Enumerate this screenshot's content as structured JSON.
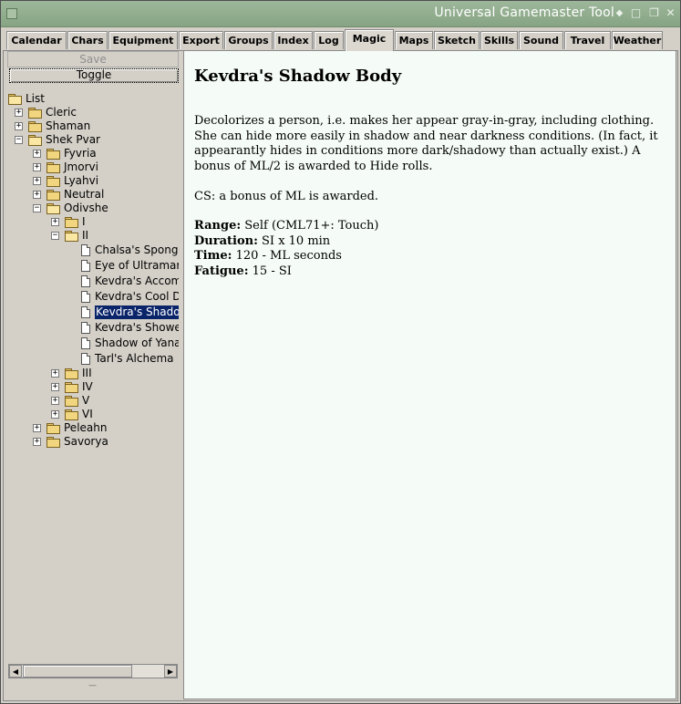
{
  "window": {
    "title": "Universal Gamemaster Tool"
  },
  "tabs": [
    {
      "label": "Calendar",
      "active": false
    },
    {
      "label": "Chars",
      "active": false
    },
    {
      "label": "Equipment",
      "active": false
    },
    {
      "label": "Export",
      "active": false
    },
    {
      "label": "Groups",
      "active": false
    },
    {
      "label": "Index",
      "active": false
    },
    {
      "label": "Log",
      "active": false
    },
    {
      "label": "Magic",
      "active": true
    },
    {
      "label": "Maps",
      "active": false
    },
    {
      "label": "Sketch",
      "active": false
    },
    {
      "label": "Skills",
      "active": false
    },
    {
      "label": "Sound",
      "active": false
    },
    {
      "label": "Travel",
      "active": false
    },
    {
      "label": "Weather",
      "active": false
    }
  ],
  "sidebar": {
    "save_label": "Save",
    "toggle_label": "Toggle",
    "tree": [
      {
        "label": "List",
        "type": "folder-open"
      },
      {
        "label": "Cleric",
        "type": "folder",
        "expander": "+"
      },
      {
        "label": "Shaman",
        "type": "folder",
        "expander": "+"
      },
      {
        "label": "Shek Pvar",
        "type": "folder-open",
        "expander": "-"
      },
      {
        "label": "Fyvria",
        "type": "folder",
        "expander": "+"
      },
      {
        "label": "Jmorvi",
        "type": "folder",
        "expander": "+"
      },
      {
        "label": "Lyahvi",
        "type": "folder",
        "expander": "+"
      },
      {
        "label": "Neutral",
        "type": "folder",
        "expander": "+"
      },
      {
        "label": "Odivshe",
        "type": "folder-open",
        "expander": "-"
      },
      {
        "label": "I",
        "type": "folder",
        "expander": "+"
      },
      {
        "label": "II",
        "type": "folder-open",
        "expander": "-"
      },
      {
        "label": "Chalsa's Sponge",
        "type": "doc"
      },
      {
        "label": "Eye of Ultramar",
        "type": "doc"
      },
      {
        "label": "Kevdra's Accom",
        "type": "doc"
      },
      {
        "label": "Kevdra's Cool D",
        "type": "doc"
      },
      {
        "label": "Kevdra's Shadov",
        "type": "doc",
        "selected": true
      },
      {
        "label": "Kevdra's Showe",
        "type": "doc"
      },
      {
        "label": "Shadow of Yana",
        "type": "doc"
      },
      {
        "label": "Tarl's Alchema",
        "type": "doc"
      },
      {
        "label": "III",
        "type": "folder",
        "expander": "+"
      },
      {
        "label": "IV",
        "type": "folder",
        "expander": "+"
      },
      {
        "label": "V",
        "type": "folder",
        "expander": "+"
      },
      {
        "label": "VI",
        "type": "folder",
        "expander": "+"
      },
      {
        "label": "Peleahn",
        "type": "folder",
        "expander": "+"
      },
      {
        "label": "Savorya",
        "type": "folder",
        "expander": "+"
      }
    ]
  },
  "spell": {
    "title": "Kevdra's Shadow Body",
    "description": "Decolorizes a person, i.e. makes her appear gray-in-gray, including clothing. She can hide more easily in shadow and near darkness conditions. (In fact, it appearantly hides in conditions more dark/shadowy than actually exist.) A bonus of ML/2 is awarded to Hide rolls.",
    "cs": "CS: a bonus of ML is awarded.",
    "stats": [
      {
        "label": "Range:",
        "value": "Self (CML71+: Touch)"
      },
      {
        "label": "Duration:",
        "value": "SI x 10 min"
      },
      {
        "label": "Time:",
        "value": "120 - ML seconds"
      },
      {
        "label": "Fatigue:",
        "value": "15 - SI"
      }
    ]
  }
}
